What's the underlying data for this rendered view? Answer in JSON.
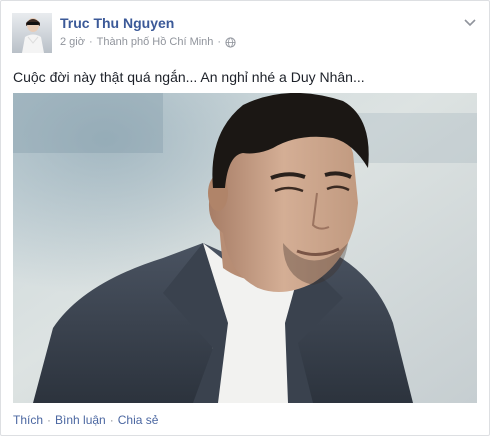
{
  "post": {
    "author": "Truc Thu Nguyen",
    "time": "2 giờ",
    "location": "Thành phố Hồ Chí Minh",
    "privacy_icon": "globe-icon",
    "menu_icon": "chevron-down-icon",
    "message": "Cuộc đời này thật quá ngắn... An nghỉ nhé a Duy Nhân...",
    "actions": {
      "like": "Thích",
      "comment": "Bình luận",
      "share": "Chia sẻ"
    }
  },
  "colors": {
    "author_link": "#3b5998",
    "action_link": "#4b67a1",
    "meta_text": "#90949c"
  }
}
